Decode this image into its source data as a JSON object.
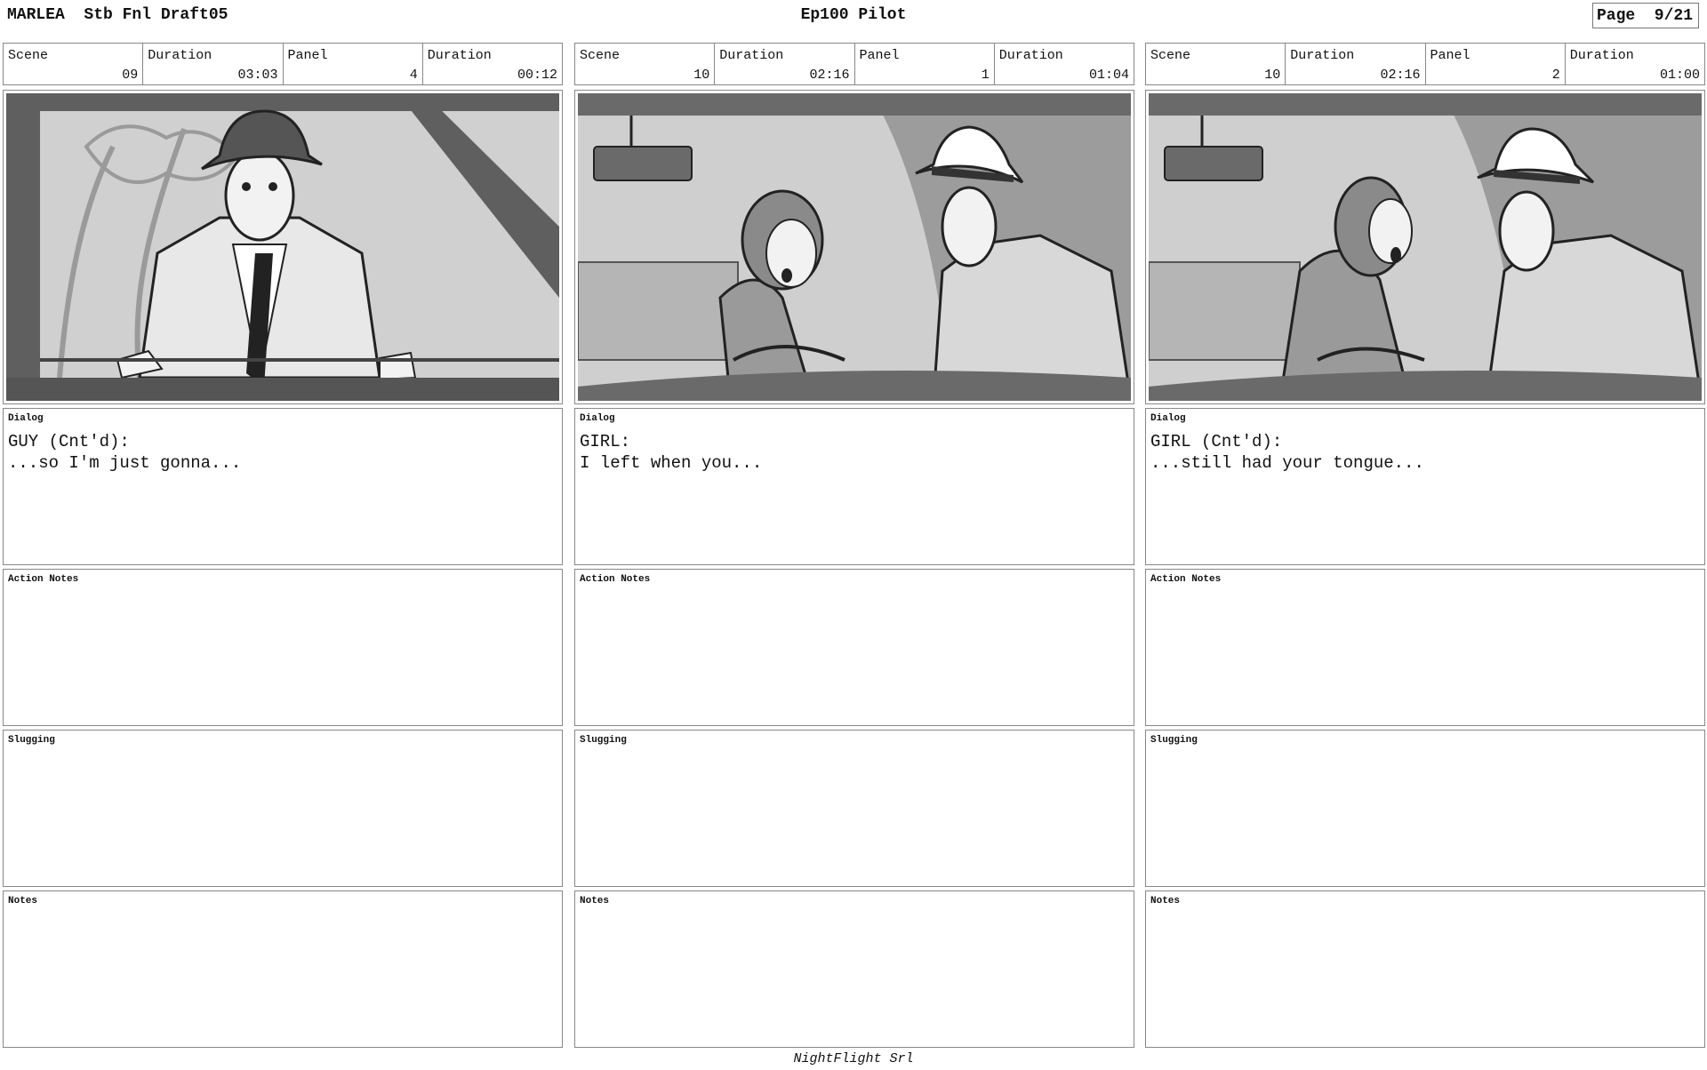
{
  "header": {
    "left": "MARLEA  Stb Fnl Draft05",
    "center": "Ep100 Pilot",
    "page": "Page  9/21"
  },
  "panels": [
    {
      "scene_label": "Scene",
      "scene": "09",
      "duration_label": "Duration",
      "duration": "03:03",
      "panel_label": "Panel",
      "panel": "4",
      "panel_duration_label": "Duration",
      "panel_duration": "00:12",
      "dialog_label": "Dialog",
      "dialog_line1": "GUY (Cnt'd):",
      "dialog_line2": "...so I'm just gonna...",
      "action_label": "Action Notes",
      "slugging_label": "Slugging",
      "notes_label": "Notes"
    },
    {
      "scene_label": "Scene",
      "scene": "10",
      "duration_label": "Duration",
      "duration": "02:16",
      "panel_label": "Panel",
      "panel": "1",
      "panel_duration_label": "Duration",
      "panel_duration": "01:04",
      "dialog_label": "Dialog",
      "dialog_line1": "GIRL:",
      "dialog_line2": "I left when you...",
      "action_label": "Action Notes",
      "slugging_label": "Slugging",
      "notes_label": "Notes"
    },
    {
      "scene_label": "Scene",
      "scene": "10",
      "duration_label": "Duration",
      "duration": "02:16",
      "panel_label": "Panel",
      "panel": "2",
      "panel_duration_label": "Duration",
      "panel_duration": "01:00",
      "dialog_label": "Dialog",
      "dialog_line1": "GIRL (Cnt'd):",
      "dialog_line2": "...still had your tongue...",
      "action_label": "Action Notes",
      "slugging_label": "Slugging",
      "notes_label": "Notes"
    }
  ],
  "footer": "NightFlight Srl"
}
